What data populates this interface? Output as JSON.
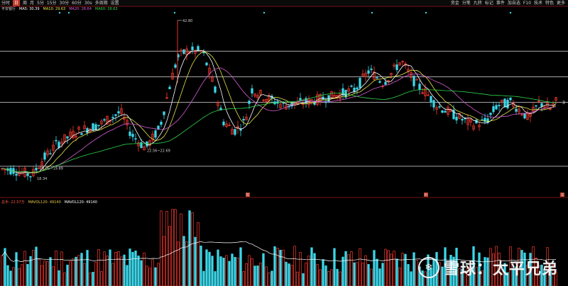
{
  "toolbar": {
    "left_items": [
      "分时",
      "日",
      "周",
      "月",
      "5分",
      "15分",
      "30分",
      "60分",
      "30s",
      "多周期",
      "设置"
    ],
    "active_index": 1,
    "right_items": [
      "资金",
      "分笔",
      "九转",
      "标记",
      "事件",
      "加自选",
      "F10",
      "技术",
      "特色",
      "更多"
    ]
  },
  "legend": {
    "name": "平安银行",
    "ma5": "MA5: 30.39",
    "ma10": "MA10: 29.63",
    "ma20": "MA20: 28.64",
    "ma60": "MA60: 28.63"
  },
  "vol_legend": {
    "vol": "总手: 22.57万",
    "mavol": "MAVOL120: 49140",
    "mavol2": "MAVOL120: 49140"
  },
  "annotations": {
    "high": "42.80",
    "low1": "18.34",
    "gap1": "19.05~19.89",
    "gap2": "22.56~22.69",
    "marker1": "陈",
    "marker2": "利",
    "marker3": "冻",
    "right_label": "3"
  },
  "colors": {
    "up": "#ff3b30",
    "down": "#3cd6e8",
    "ma5": "#ffffff",
    "ma10": "#e6e64c",
    "ma20": "#d75cd6",
    "ma60": "#2fd64a",
    "hline": "#dddddd",
    "volavg": "#ffffff"
  },
  "watermark": {
    "text": "雪球：太平兄弟"
  },
  "chart_data": {
    "type": "candlestick",
    "title": "",
    "price_range": [
      17,
      44
    ],
    "horizontal_levels": [
      38,
      34,
      30,
      20
    ],
    "labeled_points": [
      {
        "label": "42.80",
        "value": 42.8
      },
      {
        "label": "18.34",
        "value": 18.34
      },
      {
        "label": "19.05~19.89",
        "value": 19.5
      },
      {
        "label": "22.56~22.69",
        "value": 22.6
      }
    ],
    "ma_values": {
      "MA5": 30.39,
      "MA10": 29.63,
      "MA20": 28.64,
      "MA60": 28.63
    },
    "volume_ma": 49140
  }
}
